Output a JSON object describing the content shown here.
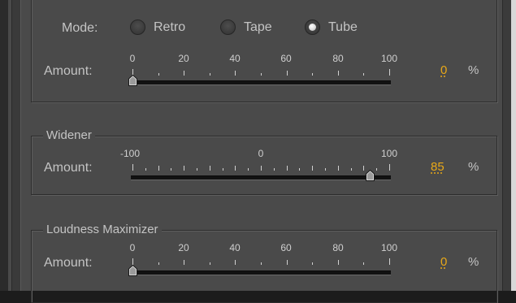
{
  "saturation": {
    "mode_label": "Mode:",
    "modes": [
      "Retro",
      "Tape",
      "Tube"
    ],
    "selected_mode": "Tube",
    "amount_label": "Amount:",
    "scale_labels": [
      "0",
      "20",
      "40",
      "60",
      "80",
      "100"
    ],
    "value": "0",
    "unit": "%",
    "level_fraction": 0.0
  },
  "widener": {
    "title": "Widener",
    "amount_label": "Amount:",
    "scale_labels": [
      "-100",
      "0",
      "100"
    ],
    "value": "85",
    "unit": "%",
    "level_fraction": 0.925
  },
  "loudness": {
    "title": "Loudness Maximizer",
    "amount_label": "Amount:",
    "scale_labels": [
      "0",
      "20",
      "40",
      "60",
      "80",
      "100"
    ],
    "value": "0",
    "unit": "%",
    "level_fraction": 0.0
  },
  "colors": {
    "panel": "#4a4a4a",
    "value_accent": "#e8a818",
    "text": "#c4c4c4"
  }
}
